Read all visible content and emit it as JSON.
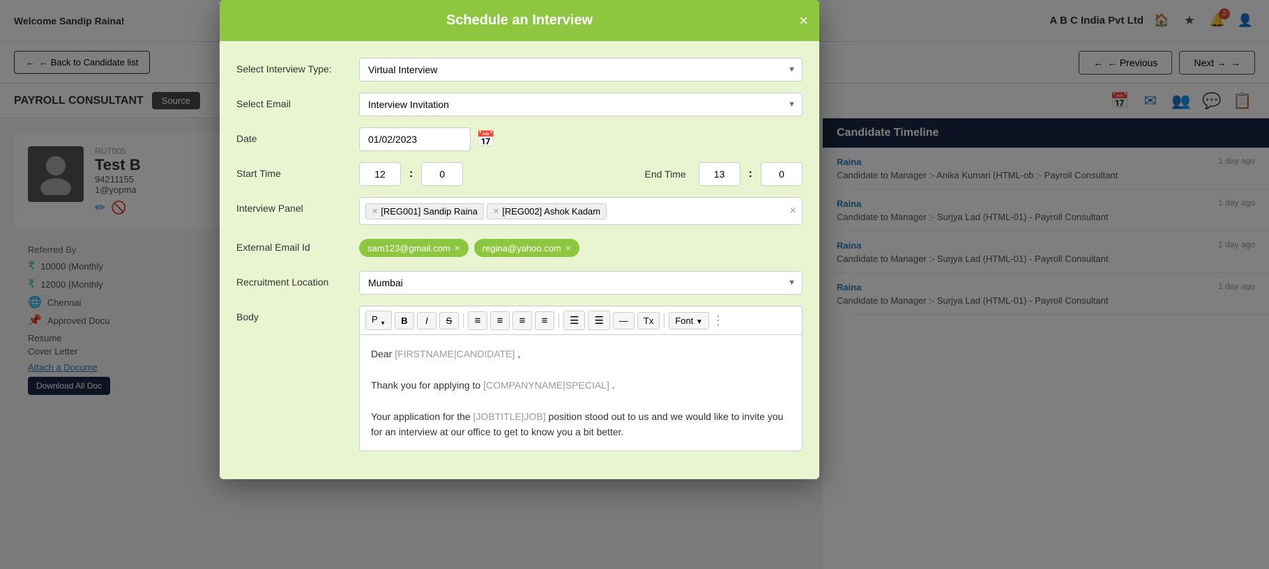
{
  "topNav": {
    "welcome": "Welcome",
    "username": "Sandip Raina!",
    "company": "A B C India Pvt Ltd"
  },
  "secondBar": {
    "backBtn": "← Back to Candidate list",
    "prevBtn": "← Previous",
    "nextBtn": "Next →"
  },
  "thirdBar": {
    "candidateTitle": "PAYROLL CONSULTANT",
    "sourceBtn": "Source"
  },
  "candidate": {
    "id": "RUT005",
    "name": "Test B",
    "phone": "94211155",
    "email": "1@yopma",
    "referredBy": "Referred By",
    "salary1": "10000 (Monthly",
    "salary2": "12000 (Monthly",
    "location": "Chennai",
    "doc1": "Approved Docu",
    "doc2": "Resume",
    "doc3": "Cover Letter",
    "attachLink": "Attach a Docume",
    "downloadBtn": "Download All Doc"
  },
  "timeline": {
    "header": "Candidate Timeline",
    "items": [
      {
        "name": "Raina",
        "time": "1 day ago",
        "text": "Candidate to Manager :- Anika Kumari (HTML-ob :- Payroll Consultant"
      },
      {
        "name": "Raina",
        "time": "1 day ago",
        "text": "Candidate to Manager :- Surjya Lad (HTML-01) - Payroll Consultant"
      },
      {
        "name": "Raina",
        "time": "1 day ago",
        "text": "Candidate to Manager :- Surjya Lad (HTML-01) - Payroll Consultant"
      },
      {
        "name": "Raina",
        "time": "1 day ago",
        "text": "Candidate to Manager :- Surjya Lad (HTML-01) - Payroll Consultant"
      }
    ]
  },
  "modal": {
    "title": "Schedule an Interview",
    "closeBtn": "×",
    "fields": {
      "interviewTypeLabel": "Select Interview Type:",
      "interviewTypeValue": "Virtual Interview",
      "selectEmailLabel": "Select Email",
      "selectEmailValue": "Interview Invitation",
      "dateLabel": "Date",
      "dateValue": "01/02/2023",
      "startTimeLabel": "Start Time",
      "startTimeHour": "12",
      "startTimeMin": "0",
      "endTimeLabel": "End Time",
      "endTimeHour": "13",
      "endTimeMin": "0",
      "interviewPanelLabel": "Interview Panel",
      "panelMember1": "[REG001] Sandip Raina",
      "panelMember2": "[REG002] Ashok Kadam",
      "externalEmailLabel": "External Email Id",
      "email1": "sam123@gmail.com",
      "email2": "regina@yahoo.com",
      "recruitmentLocLabel": "Recruitment Location",
      "recruitmentLocValue": "Mumbai",
      "bodyLabel": "Body"
    },
    "toolbar": {
      "p": "P",
      "bold": "B",
      "italic": "I",
      "strike": "S",
      "alignLeft": "≡",
      "alignCenter": "≡",
      "alignRight": "≡",
      "justify": "≡",
      "ul": "≡",
      "ol": "≡",
      "hr": "—",
      "clearFormat": "Tx",
      "font": "Font",
      "fontDropArrow": "▼"
    },
    "bodyContent": {
      "line1": "Dear [FIRSTNAME|CANDIDATE],",
      "line2": "Thank you for applying to [COMPANYNAME|SPECIAL].",
      "line3": "Your application for the [JOBTITLE|JOB] position stood out to us and we would like to invite you for an interview at our office to get to know you a bit better."
    }
  }
}
